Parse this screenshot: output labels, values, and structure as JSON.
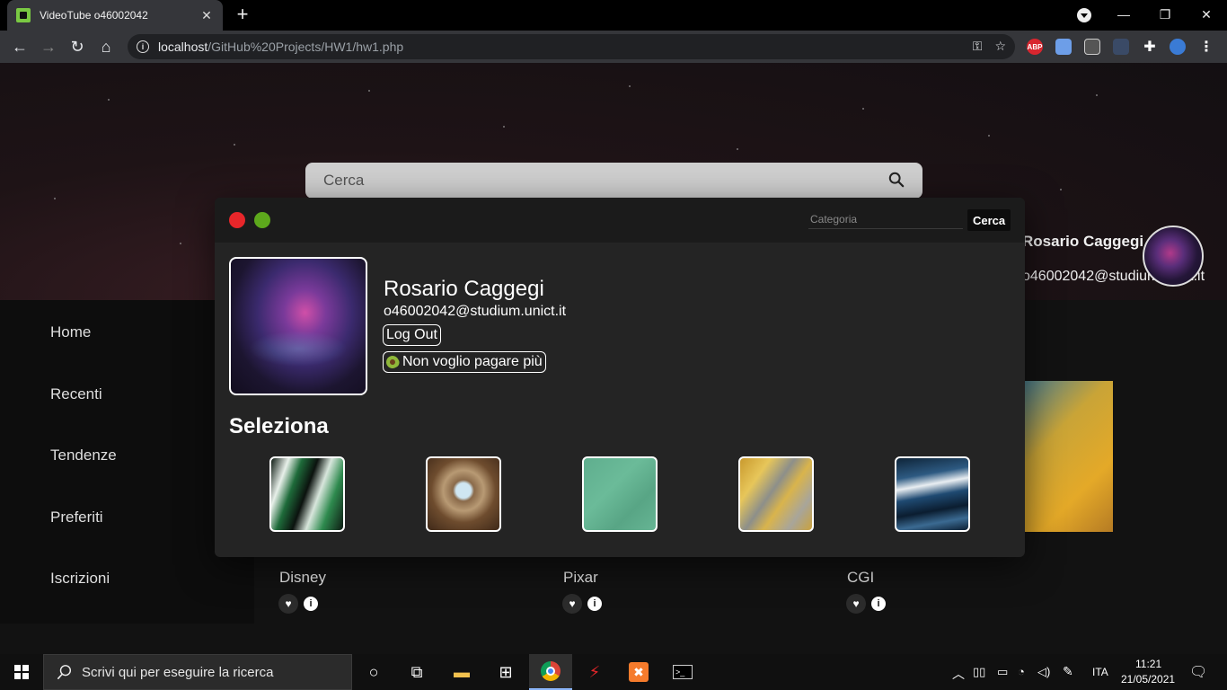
{
  "browser": {
    "tab_title": "VideoTube o46002042",
    "tab_close": "✕",
    "new_tab": "+",
    "url_host": "localhost",
    "url_path": "/GitHub%20Projects/HW1/hw1.php",
    "extensions": [
      "ABP"
    ]
  },
  "hero": {
    "search_placeholder": "Cerca",
    "user_name": "Rosario Caggegi",
    "user_email": "o46002042@studium.unict.it"
  },
  "sidebar": {
    "items": [
      {
        "label": "Home"
      },
      {
        "label": "Recenti"
      },
      {
        "label": "Tendenze"
      },
      {
        "label": "Preferiti"
      },
      {
        "label": "Iscrizioni"
      }
    ]
  },
  "cards": [
    {
      "category": "Disney"
    },
    {
      "category": "Pixar"
    },
    {
      "category": "CGI"
    }
  ],
  "modal": {
    "category_placeholder": "Categoria",
    "search_button": "Cerca",
    "profile_name": "Rosario Caggegi",
    "profile_email": "o46002042@studium.unict.it",
    "logout_button": "Log Out",
    "unsubscribe_button": "Non voglio pagare più",
    "select_title": "Seleziona",
    "dot_colors": [
      "#e8262a",
      "#5da81c"
    ],
    "swatches": [
      {
        "name": "green-marble-swatch"
      },
      {
        "name": "gold-geometric-swatch"
      },
      {
        "name": "teal-texture-swatch"
      },
      {
        "name": "golden-aerial-swatch"
      },
      {
        "name": "ocean-waves-swatch"
      }
    ]
  },
  "taskbar": {
    "search_placeholder": "Scrivi qui per eseguire la ricerca",
    "language": "ITA",
    "time": "11:21",
    "date": "21/05/2021"
  }
}
